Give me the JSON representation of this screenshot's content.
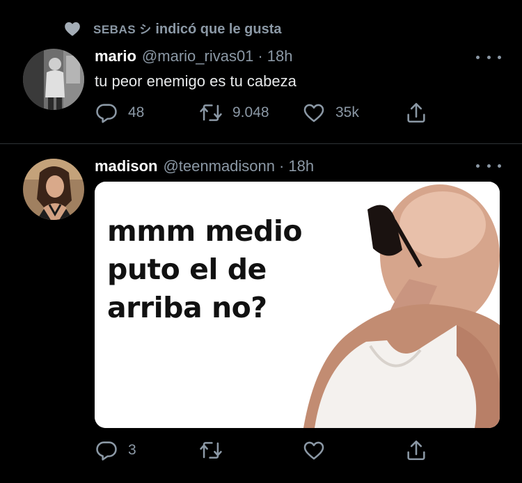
{
  "social_context": {
    "name": "SEBAS シ",
    "action": " indicó que le gusta",
    "icon": "heart-filled-icon"
  },
  "tweets": [
    {
      "display_name": "mario",
      "handle": "@mario_rivas01",
      "separator": "·",
      "time": "18h",
      "text": "tu peor enemigo es tu cabeza",
      "replies": "48",
      "retweets": "9.048",
      "likes": "35k"
    },
    {
      "display_name": "madison",
      "handle": "@teenmadisonn",
      "separator": "·",
      "time": "18h",
      "media_text": [
        "mmm medio",
        "puto el de",
        "arriba no?"
      ],
      "replies": "3",
      "retweets": "",
      "likes": ""
    }
  ],
  "colors": {
    "background": "#000000",
    "secondary_text": "#8b98a5",
    "divider": "#2f3336"
  }
}
